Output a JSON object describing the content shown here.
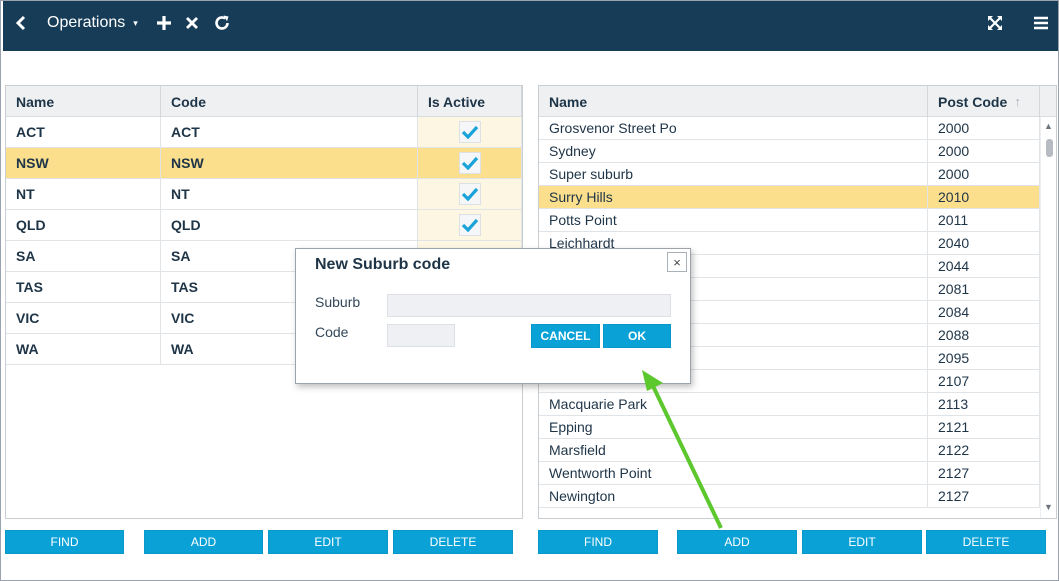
{
  "header": {
    "title": "Operations",
    "caret": "▾"
  },
  "left_grid": {
    "columns": [
      "Name",
      "Code",
      "Is Active"
    ],
    "rows": [
      {
        "name": "ACT",
        "code": "ACT",
        "active": true,
        "selected": false
      },
      {
        "name": "NSW",
        "code": "NSW",
        "active": true,
        "selected": true
      },
      {
        "name": "NT",
        "code": "NT",
        "active": true,
        "selected": false
      },
      {
        "name": "QLD",
        "code": "QLD",
        "active": true,
        "selected": false
      },
      {
        "name": "SA",
        "code": "SA",
        "active": false,
        "selected": false
      },
      {
        "name": "TAS",
        "code": "TAS",
        "active": false,
        "selected": false
      },
      {
        "name": "VIC",
        "code": "VIC",
        "active": false,
        "selected": false
      },
      {
        "name": "WA",
        "code": "WA",
        "active": false,
        "selected": false
      }
    ]
  },
  "right_grid": {
    "columns": [
      "Name",
      "Post Code"
    ],
    "sort_indicator": "↑",
    "rows": [
      {
        "name": "Grosvenor Street Po",
        "post_code": "2000",
        "selected": false
      },
      {
        "name": "Sydney",
        "post_code": "2000",
        "selected": false
      },
      {
        "name": "Super suburb",
        "post_code": "2000",
        "selected": false
      },
      {
        "name": "Surry Hills",
        "post_code": "2010",
        "selected": true
      },
      {
        "name": "Potts Point",
        "post_code": "2011",
        "selected": false
      },
      {
        "name": "Leichhardt",
        "post_code": "2040",
        "selected": false
      },
      {
        "name": "",
        "post_code": "2044",
        "selected": false
      },
      {
        "name": "",
        "post_code": "2081",
        "selected": false
      },
      {
        "name": "",
        "post_code": "2084",
        "selected": false
      },
      {
        "name": "",
        "post_code": "2088",
        "selected": false
      },
      {
        "name": "",
        "post_code": "2095",
        "selected": false
      },
      {
        "name": "",
        "post_code": "2107",
        "selected": false
      },
      {
        "name": "Macquarie Park",
        "post_code": "2113",
        "selected": false
      },
      {
        "name": "Epping",
        "post_code": "2121",
        "selected": false
      },
      {
        "name": "Marsfield",
        "post_code": "2122",
        "selected": false
      },
      {
        "name": "Wentworth Point",
        "post_code": "2127",
        "selected": false
      },
      {
        "name": "Newington",
        "post_code": "2127",
        "selected": false
      }
    ]
  },
  "left_buttons": {
    "find": "FIND",
    "add": "ADD",
    "edit": "EDIT",
    "delete": "DELETE"
  },
  "right_buttons": {
    "find": "FIND",
    "add": "ADD",
    "edit": "EDIT",
    "delete": "DELETE"
  },
  "dialog": {
    "title": "New Suburb code",
    "close": "×",
    "suburb_label": "Suburb",
    "suburb_value": "",
    "code_label": "Code",
    "code_value": "",
    "cancel_label": "CANCEL",
    "ok_label": "OK"
  },
  "colors": {
    "header_bg": "#163c58",
    "button": "#0aa2d6",
    "selected_row": "#fbdf8d",
    "checkmark": "#1aa3d9",
    "annotation_arrow": "#5cc82d"
  }
}
